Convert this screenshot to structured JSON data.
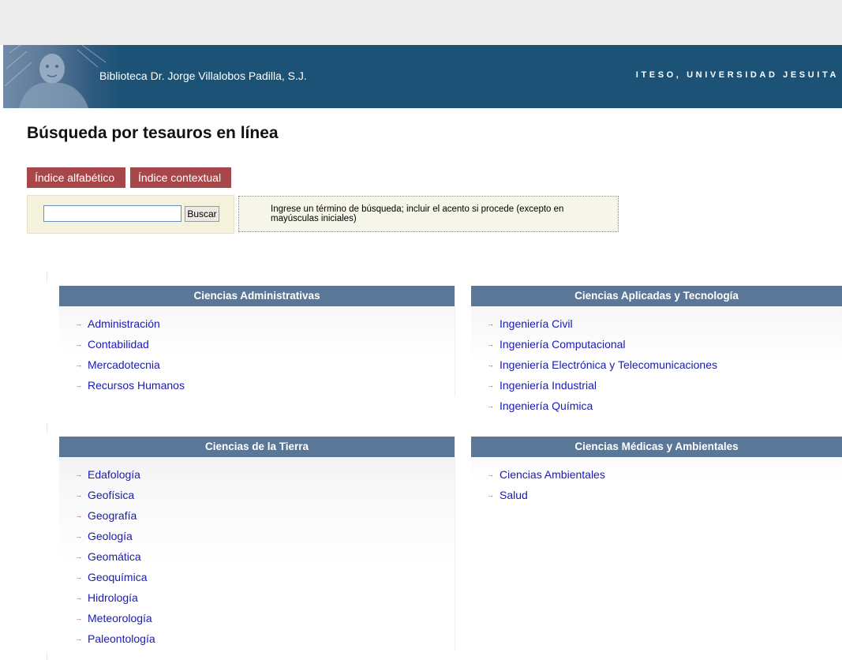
{
  "header": {
    "library_name": "Biblioteca Dr. Jorge Villalobos Padilla, S.J.",
    "university": "ITESO, UNIVERSIDAD JESUITA"
  },
  "page_title": "Búsqueda por tesauros en línea",
  "tabs": [
    {
      "label": "Índice alfabético"
    },
    {
      "label": "Índice contextual"
    }
  ],
  "search": {
    "value": "",
    "placeholder": "",
    "button_label": "Buscar",
    "help_text": "Ingrese un término de búsqueda; incluir el acento si procede (excepto en mayúsculas iniciales)"
  },
  "categories": [
    {
      "title": "Ciencias Administrativas",
      "items": [
        "Administración",
        "Contabilidad",
        "Mercadotecnia",
        "Recursos Humanos"
      ]
    },
    {
      "title": "Ciencias Aplicadas y Tecnología",
      "items": [
        "Ingeniería Civil",
        "Ingeniería Computacional",
        "Ingeniería Electrónica y Telecomunicaciones",
        "Ingeniería Industrial",
        "Ingeniería Química"
      ]
    },
    {
      "title": "Ciencias de la Tierra",
      "items": [
        "Edafología",
        "Geofísica",
        "Geografía",
        "Geología",
        "Geomática",
        "Geoquímica",
        "Hidrología",
        "Meteorología",
        "Paleontología"
      ]
    },
    {
      "title": "Ciencias Médicas y Ambientales",
      "items": [
        "Ciencias Ambientales",
        "Salud"
      ]
    }
  ],
  "colors": {
    "banner": "#1b5276",
    "tab": "#a8474a",
    "panel_header": "#5b7797",
    "link": "#1a1ab0"
  },
  "icons": {
    "list_bullet": "arrow-right-icon"
  }
}
